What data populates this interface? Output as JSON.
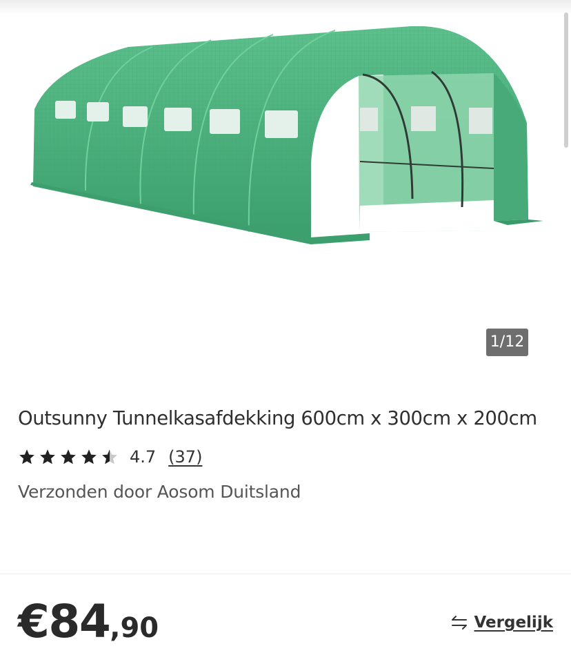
{
  "gallery": {
    "image_alt": "Outsunny Tunnelkasafdekking",
    "counter": "1/12"
  },
  "product": {
    "title": "Outsunny Tunnelkasafdekking 600cm x 300cm x 200cm",
    "rating": 4.7,
    "rating_text": "4.7",
    "review_count": "(37)",
    "seller_text": "Verzonden door Aosom Duitsland"
  },
  "price": {
    "main": "€84",
    "cents": ",90"
  },
  "compare": {
    "label": "Vergelijk",
    "icon": "compare-arrows-icon"
  },
  "colors": {
    "greenhouse_green": "#4fb07e",
    "counter_bg": "#6e6e6e",
    "text": "#2a2a2a"
  }
}
